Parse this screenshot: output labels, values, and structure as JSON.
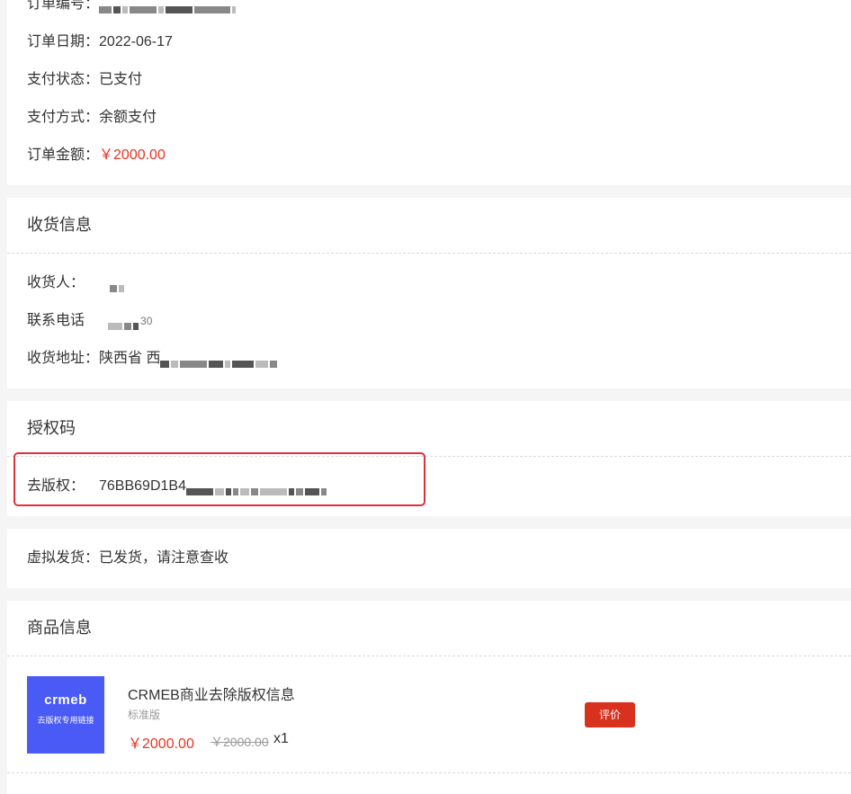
{
  "order": {
    "number_label": "订单编号：",
    "date_label": "订单日期：",
    "date_value": "2022-06-17",
    "pay_status_label": "支付状态：",
    "pay_status_value": "已支付",
    "pay_method_label": "支付方式：",
    "pay_method_value": "余额支付",
    "amount_label": "订单金额：",
    "amount_value": "￥2000.00"
  },
  "shipping": {
    "title": "收货信息",
    "receiver_label": "收货人：",
    "phone_label": "联系电话",
    "phone_partial": "30",
    "address_label": "收货地址：",
    "address_value": "陕西省 西"
  },
  "license": {
    "title": "授权码",
    "label": "去版权：",
    "code_partial": "76BB69D1B4"
  },
  "virtual": {
    "label": "虚拟发货：",
    "value": "已发货，请注意查收"
  },
  "product": {
    "title": "商品信息",
    "thumb_logo": "crmeb",
    "thumb_sub": "去版权专用链接",
    "name": "CRMEB商业去除版权信息",
    "spec": "标准版",
    "price": "￥2000.00",
    "original_price": "￥2000.00",
    "qty": "x1",
    "review_button": "评价"
  },
  "colors": {
    "accent": "#e93323",
    "highlight": "#e0303a",
    "thumb_bg": "#4a5af5"
  }
}
